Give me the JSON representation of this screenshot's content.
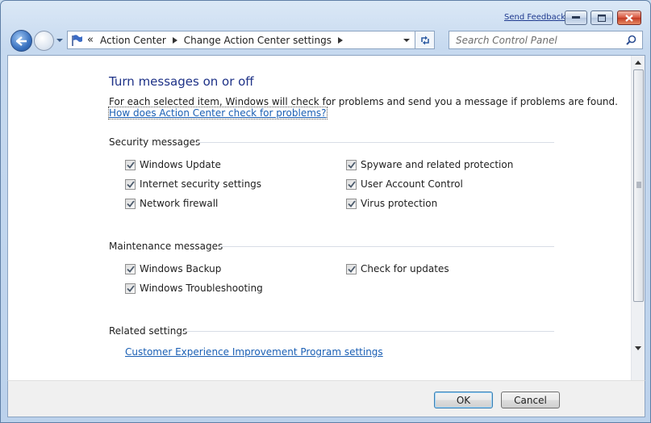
{
  "titlebar": {
    "send_feedback": "Send Feedback"
  },
  "address": {
    "more_glyph": "«",
    "crumbs": [
      "Action Center",
      "Change Action Center settings"
    ]
  },
  "search": {
    "placeholder": "Search Control Panel"
  },
  "main": {
    "heading": "Turn messages on or off",
    "description": "For each selected item, Windows will check for problems and send you a message if problems are found.",
    "help_link": "How does Action Center check for problems?",
    "security": {
      "title": "Security messages",
      "left": [
        {
          "label": "Windows Update",
          "checked": true
        },
        {
          "label": "Internet security settings",
          "checked": true
        },
        {
          "label": "Network firewall",
          "checked": true
        }
      ],
      "right": [
        {
          "label": "Spyware and related protection",
          "checked": true
        },
        {
          "label": "User Account Control",
          "checked": true
        },
        {
          "label": "Virus protection",
          "checked": true
        }
      ]
    },
    "maintenance": {
      "title": "Maintenance messages",
      "left": [
        {
          "label": "Windows Backup",
          "checked": true
        },
        {
          "label": "Windows Troubleshooting",
          "checked": true
        }
      ],
      "right": [
        {
          "label": "Check for updates",
          "checked": true
        }
      ]
    },
    "related": {
      "title": "Related settings",
      "partial_link": "Customer Experience Improvement Program settings"
    }
  },
  "footer": {
    "ok_label": "OK",
    "cancel_label": "Cancel"
  },
  "colors": {
    "heading": "#1e3287",
    "link": "#1a5fb4",
    "chrome": "#c6d9ef"
  }
}
